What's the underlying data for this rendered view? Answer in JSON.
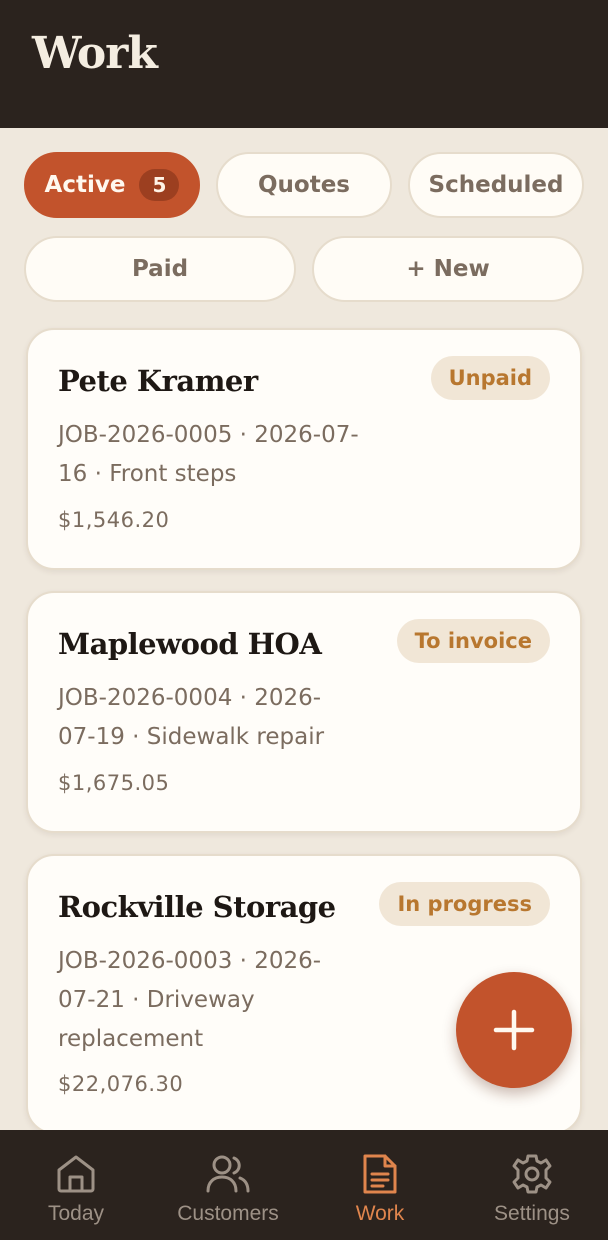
{
  "header": {
    "title": "Work"
  },
  "filters": {
    "active": {
      "label": "Active",
      "count": "5"
    },
    "quotes": "Quotes",
    "scheduled": "Scheduled",
    "paid": "Paid",
    "new": "+ New"
  },
  "jobs": [
    {
      "customer": "Pete Kramer",
      "status": "Unpaid",
      "line1": "JOB-2026-0005 · 2026-07-",
      "line2": "16 · Front steps",
      "line3": "",
      "amount": "$1,546.20"
    },
    {
      "customer": "Maplewood HOA",
      "status": "To invoice",
      "line1": "JOB-2026-0004 · 2026-",
      "line2": "07-19 · Sidewalk repair",
      "line3": "",
      "amount": "$1,675.05"
    },
    {
      "customer": "Rockville Storage",
      "status": "In progress",
      "line1": "JOB-2026-0003 · 2026-",
      "line2": "07-21 · Driveway",
      "line3": "replacement",
      "amount": "$22,076.30"
    }
  ],
  "nav": {
    "items": [
      {
        "label": "Today",
        "icon": "home-icon"
      },
      {
        "label": "Customers",
        "icon": "users-icon"
      },
      {
        "label": "Work",
        "icon": "document-icon"
      },
      {
        "label": "Settings",
        "icon": "gear-icon"
      }
    ],
    "selected": "Work"
  },
  "colors": {
    "accent": "#c2532c",
    "header_bg": "#2b231e",
    "page_bg": "#efe8dd",
    "badge_text": "#b8772f",
    "nav_selected": "#e0854d"
  }
}
